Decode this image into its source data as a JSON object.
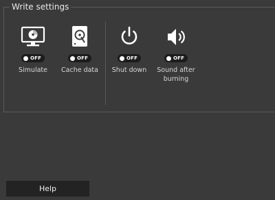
{
  "group": {
    "title": "Write settings"
  },
  "options": [
    {
      "icon": "monitor-disc-icon",
      "toggle": "OFF",
      "label": "Simulate"
    },
    {
      "icon": "hard-drive-icon",
      "toggle": "OFF",
      "label": "Cache data"
    },
    {
      "icon": "power-icon",
      "toggle": "OFF",
      "label": "Shut down"
    },
    {
      "icon": "speaker-icon",
      "toggle": "OFF",
      "label": "Sound after\nburning"
    }
  ],
  "help": {
    "label": "Help"
  },
  "colors": {
    "background": "#3a3a3a",
    "border": "#5a5a5a",
    "toggle_bg": "#1c1c1c",
    "button_bg": "#232323",
    "text": "#d8d8d8"
  }
}
